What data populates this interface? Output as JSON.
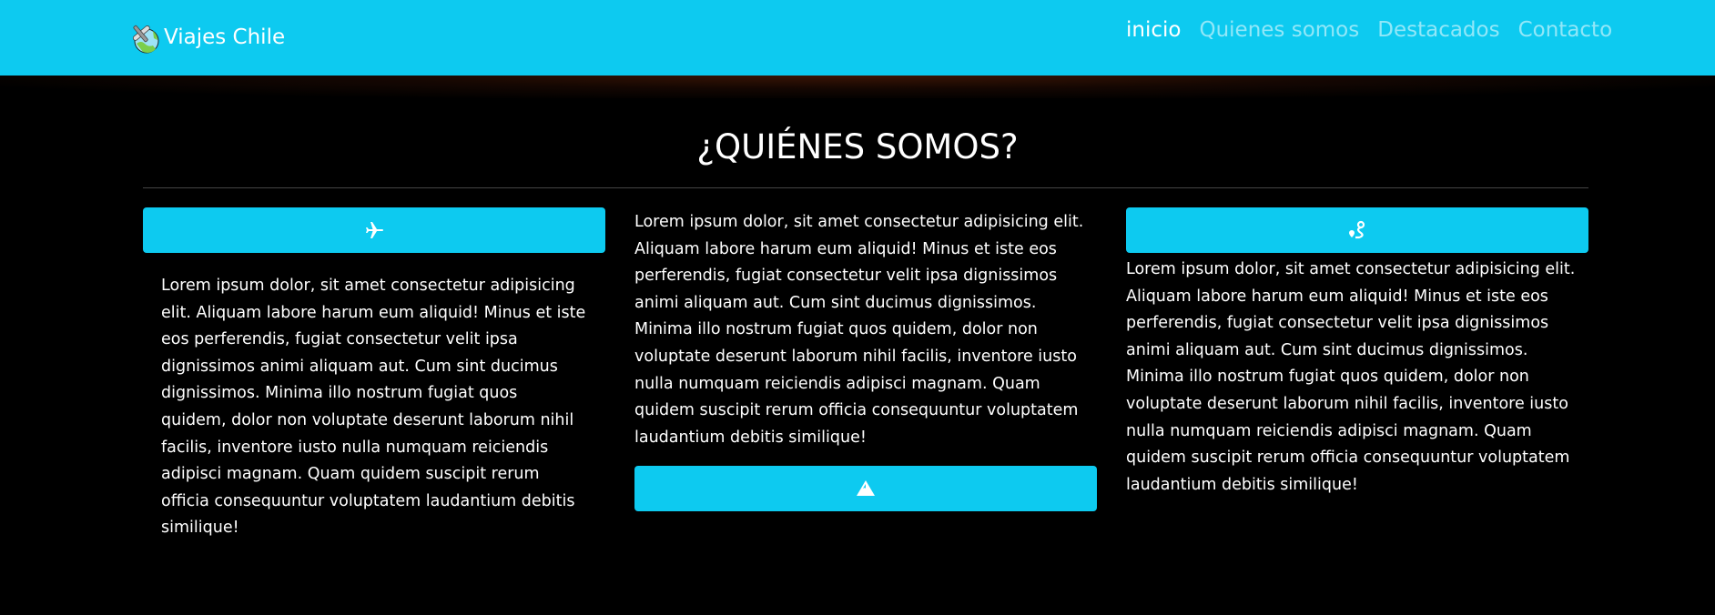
{
  "navbar": {
    "brand": "Viajes Chile",
    "links": [
      "inicio",
      "Quienes somos",
      "Destacados",
      "Contacto"
    ],
    "active": "inicio"
  },
  "section": {
    "title": "¿QUIÉNES SOMOS?",
    "text": "Lorem ipsum dolor, sit amet consectetur adipisicing elit. Aliquam labore harum eum aliquid! Minus et iste eos perferendis, fugiat consectetur velit ipsa dignissimos animi aliquam aut. Cum sint ducimus dignissimos. Minima illo nostrum fugiat quos quidem, dolor non voluptate deserunt laborum nihil facilis, inventore iusto nulla numquam reiciendis adipisci magnam. Quam quidem suscipit rerum officia consequuntur voluptatem laudantium debitis similique!",
    "cards": [
      {
        "icon": "plane-icon"
      },
      {
        "icon": "mountain-icon"
      },
      {
        "icon": "route-icon"
      }
    ]
  },
  "colors": {
    "accent": "#0dcaf0",
    "background": "#000000"
  }
}
